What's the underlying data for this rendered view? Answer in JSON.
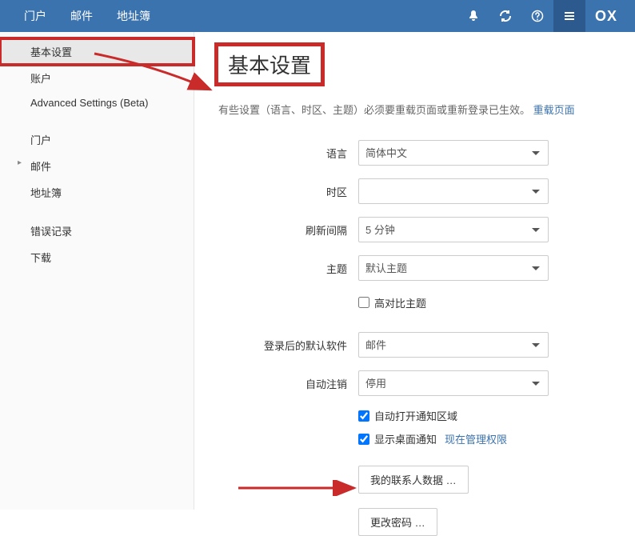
{
  "topbar": {
    "items": [
      "门户",
      "邮件",
      "地址簿"
    ],
    "logo": "OX"
  },
  "sidebar": {
    "items": [
      {
        "label": "基本设置",
        "selected": true,
        "highlighted": true
      },
      {
        "label": "账户"
      },
      {
        "label": "Advanced Settings (Beta)"
      }
    ],
    "group2": [
      {
        "label": "门户"
      },
      {
        "label": "邮件",
        "expandable": true
      },
      {
        "label": "地址簿"
      }
    ],
    "group3": [
      {
        "label": "错误记录"
      },
      {
        "label": "下载"
      }
    ]
  },
  "main": {
    "title": "基本设置",
    "notice": "有些设置（语言、时区、主题）必须要重载页面或重新登录已生效。",
    "reload": "重载页面",
    "labels": {
      "language": "语言",
      "timezone": "时区",
      "refresh": "刷新间隔",
      "theme": "主题",
      "highContrast": "高对比主题",
      "defaultApp": "登录后的默认软件",
      "autoLogout": "自动注销",
      "autoOpenNotify": "自动打开通知区域",
      "desktopNotify": "显示桌面通知",
      "manageNow": "现在管理权限",
      "myContacts": "我的联系人数据 …",
      "changePassword": "更改密码 …"
    },
    "values": {
      "language": "简体中文",
      "timezone": "",
      "refresh": "5 分钟",
      "theme": "默认主题",
      "defaultApp": "邮件",
      "autoLogout": "停用"
    }
  }
}
